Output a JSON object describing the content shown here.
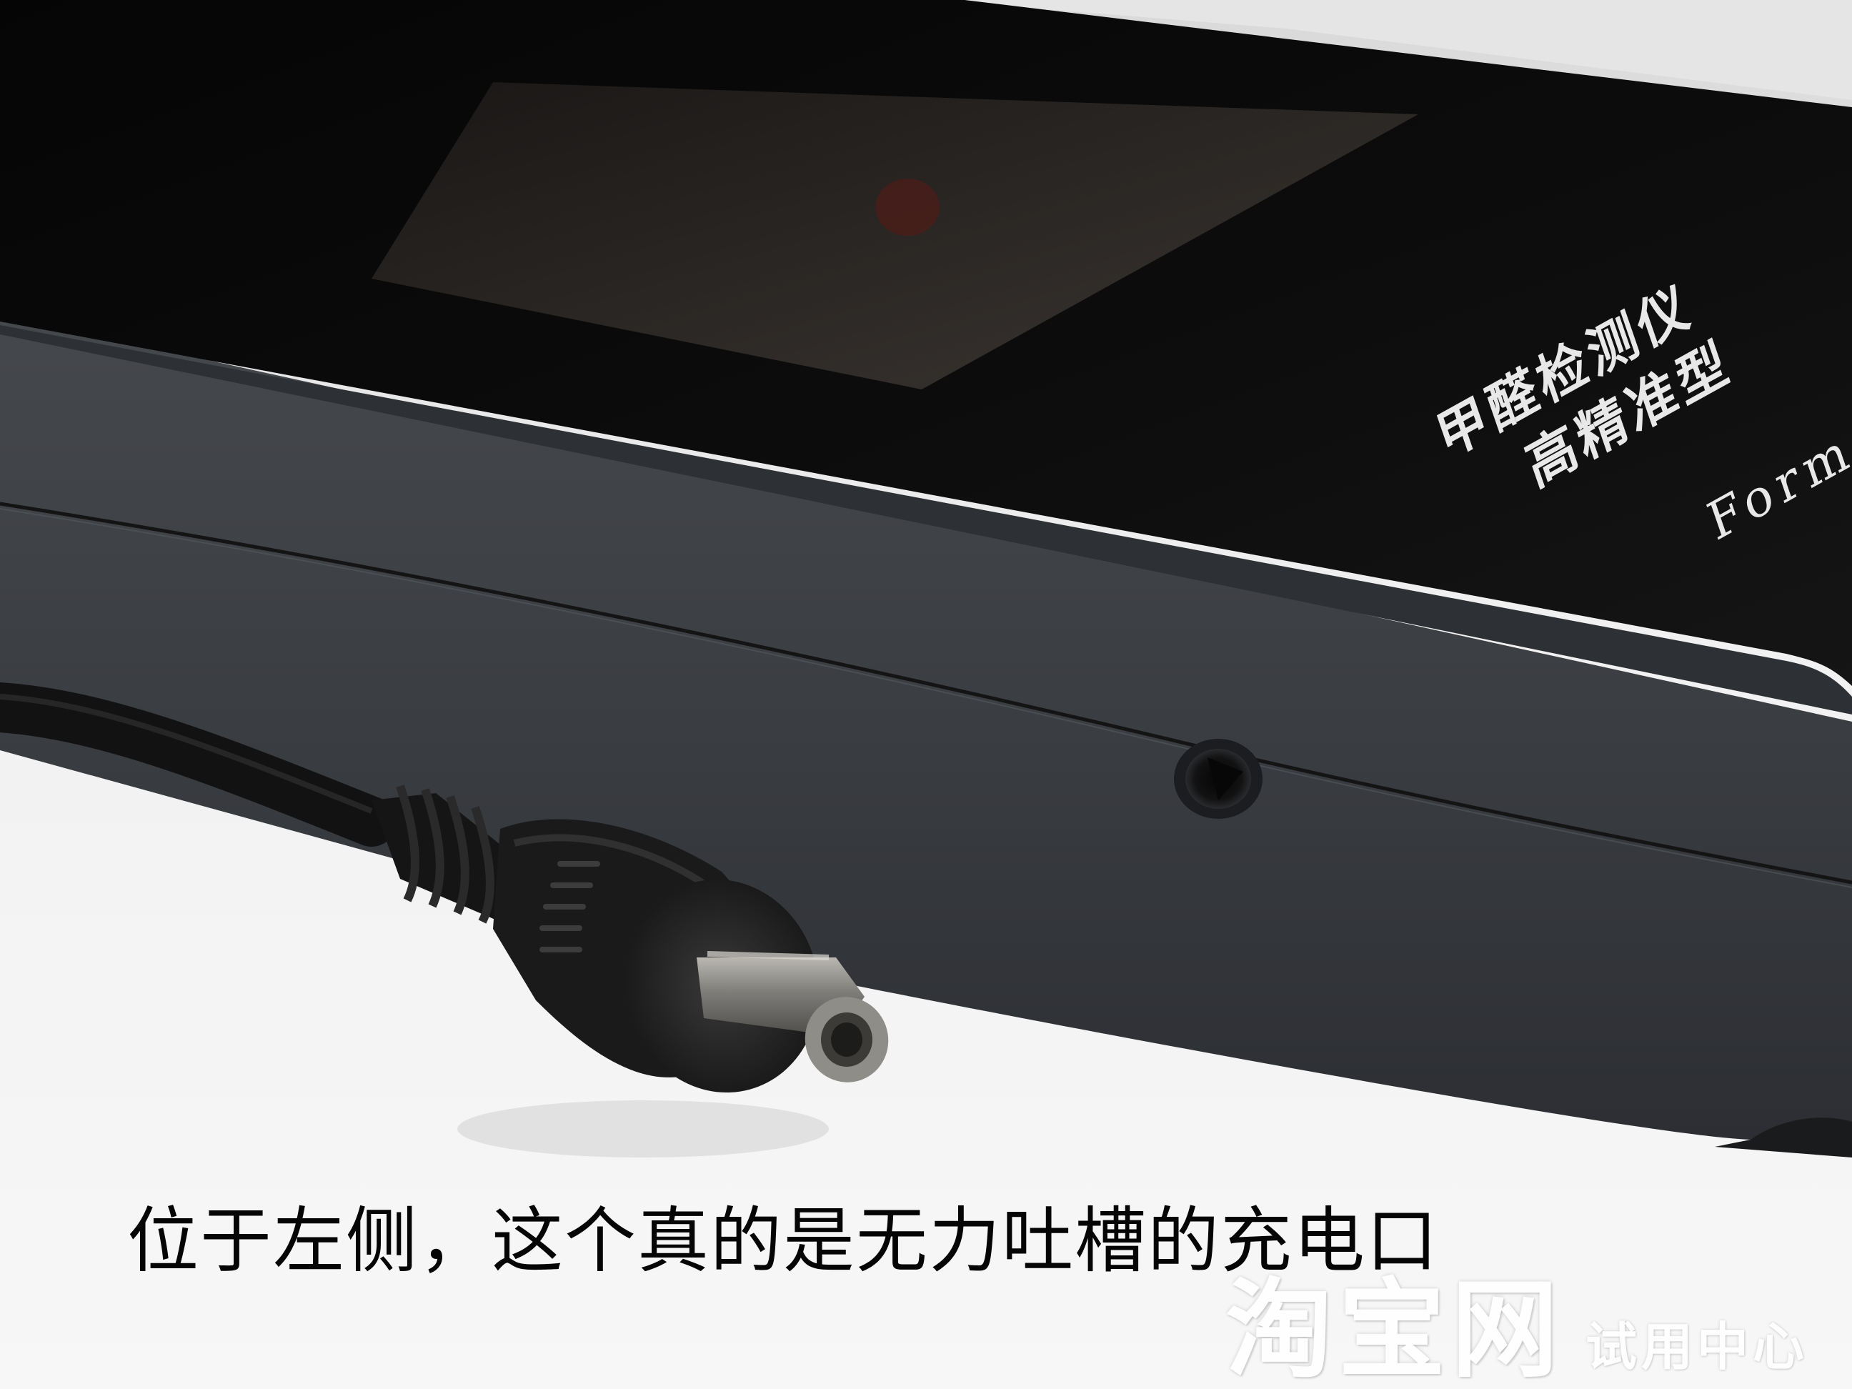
{
  "device": {
    "label_line1": "甲醛检测仪",
    "label_line2": "高精准型",
    "model_text": "Formal"
  },
  "caption": "位于左侧，这个真的是无力吐槽的充电口",
  "watermark": {
    "brand": "淘宝网",
    "section": "试用中心"
  },
  "colors": {
    "background": "#f4f4f4",
    "device_body": "#3a3d42",
    "device_top": "#0c0c0c",
    "screen": "#2a2623",
    "cable": "#141414",
    "plug_pin": "#8a8a86",
    "caption_text": "#050505",
    "watermark_text": "#ffffff"
  }
}
